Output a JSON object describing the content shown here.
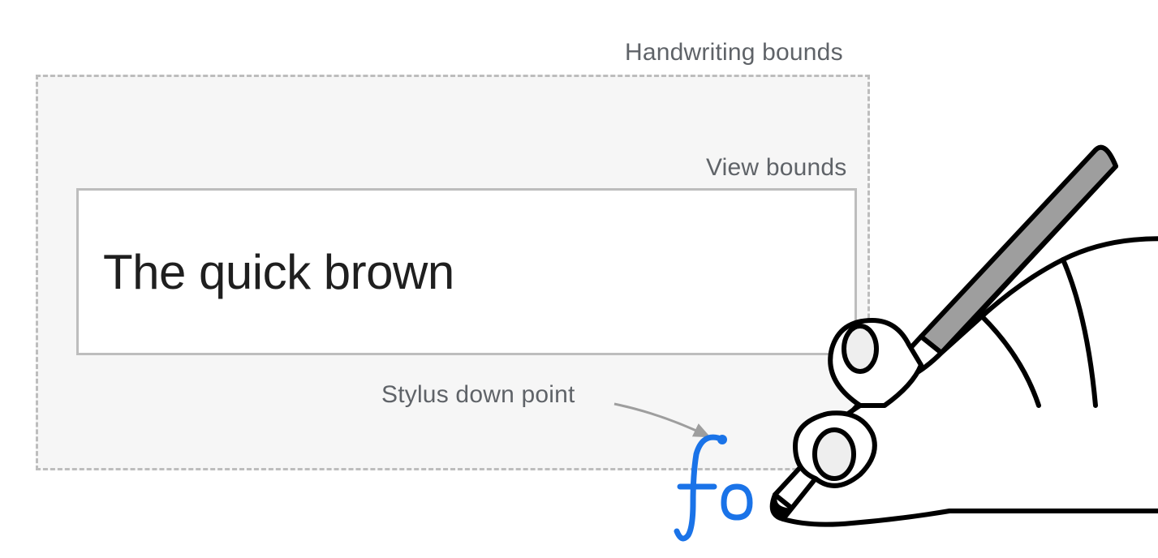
{
  "labels": {
    "handwriting_bounds": "Handwriting bounds",
    "view_bounds": "View bounds",
    "stylus_down_point": "Stylus down point"
  },
  "input": {
    "text": "The quick brown"
  },
  "handwriting": {
    "letters": "fo",
    "color": "#1a73e8"
  }
}
